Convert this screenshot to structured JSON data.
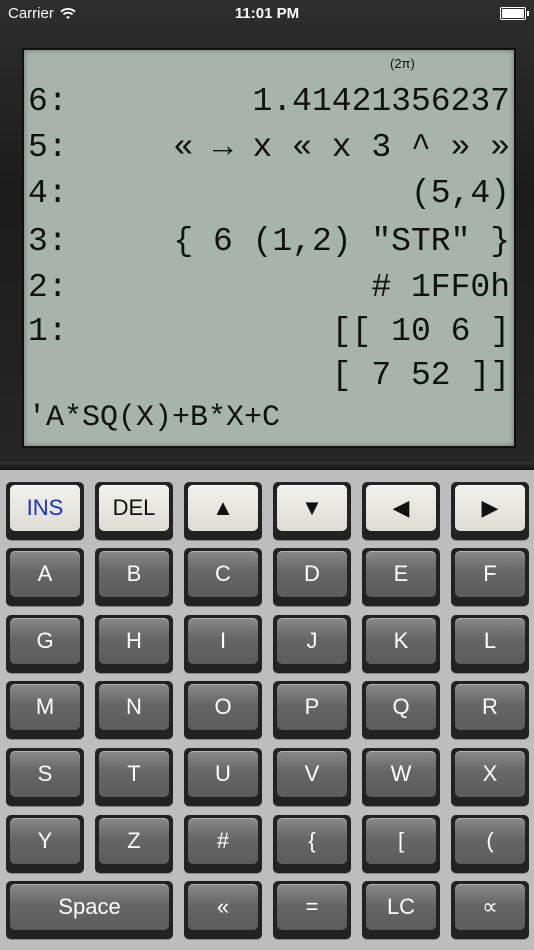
{
  "status": {
    "carrier": "Carrier",
    "time": "11:01 PM"
  },
  "display": {
    "angle_mode": "(2π)",
    "stack": [
      {
        "level": "6:",
        "value": "1.41421356237"
      },
      {
        "level": "5:",
        "value": "« → x « x 3 ^ » »"
      },
      {
        "level": "4:",
        "value": "(5,4)"
      },
      {
        "level": "3:",
        "value": "{ 6 (1,2) \"STR\" }"
      },
      {
        "level": "2:",
        "value": "# 1FF0h"
      },
      {
        "level": "1:",
        "value": "[[ 10 6 ]"
      },
      {
        "level": "",
        "value": "[ 7 52 ]]"
      }
    ],
    "command_line": "'A*SQ(X)+B*X+C"
  },
  "keys": {
    "nav": [
      "INS",
      "DEL",
      "▲",
      "▼",
      "◀",
      "▶"
    ],
    "row1": [
      "A",
      "B",
      "C",
      "D",
      "E",
      "F"
    ],
    "row2": [
      "G",
      "H",
      "I",
      "J",
      "K",
      "L"
    ],
    "row3": [
      "M",
      "N",
      "O",
      "P",
      "Q",
      "R"
    ],
    "row4": [
      "S",
      "T",
      "U",
      "V",
      "W",
      "X"
    ],
    "row5": [
      "Y",
      "Z",
      "#",
      "{",
      "[",
      "("
    ],
    "bottom": [
      "Space",
      "«",
      "=",
      "LC",
      "∝"
    ]
  }
}
